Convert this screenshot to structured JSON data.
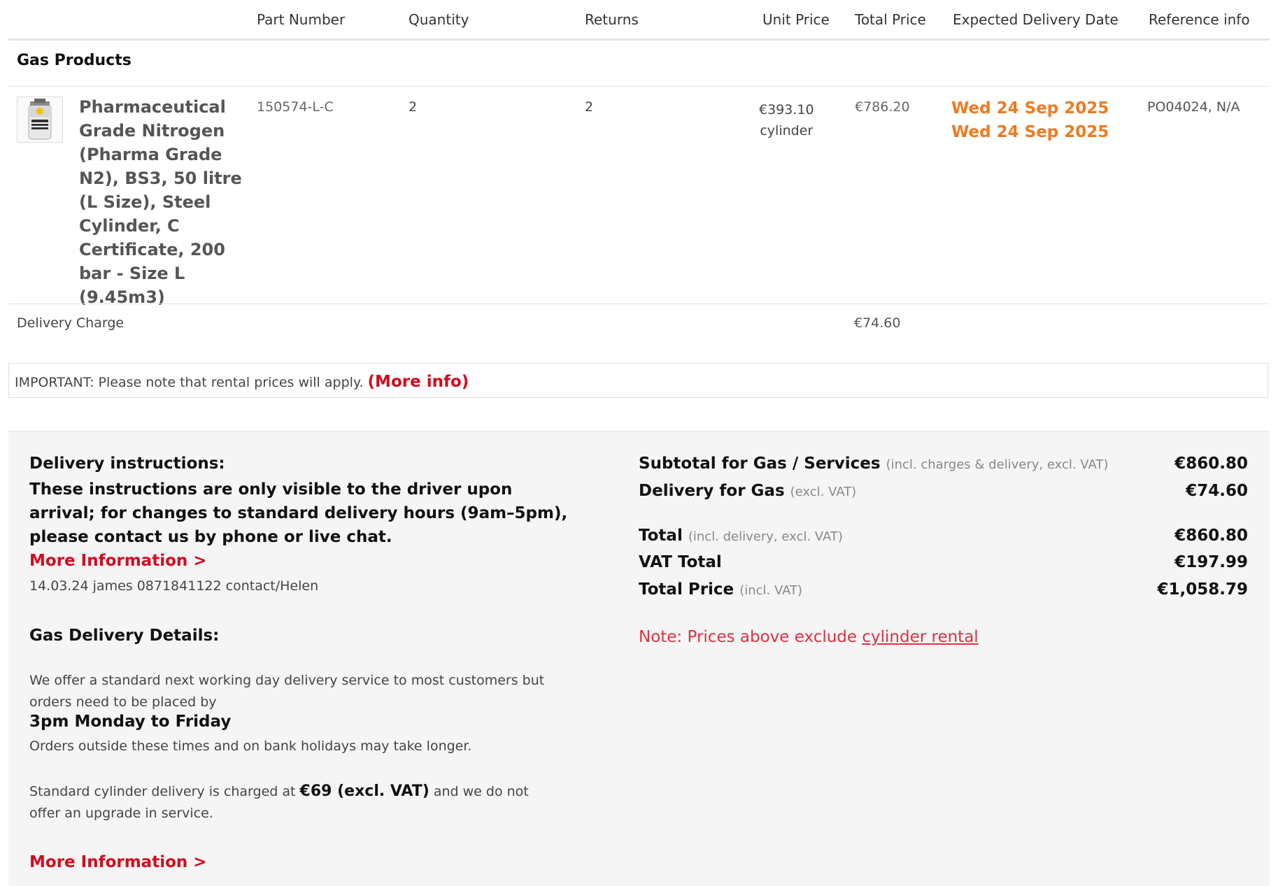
{
  "table": {
    "headers": {
      "part_number": "Part Number",
      "quantity": "Quantity",
      "returns": "Returns",
      "unit_price": "Unit Price",
      "total_price": "Total Price",
      "delivery_date": "Expected Delivery Date",
      "reference": "Reference info"
    },
    "section_title": "Gas Products",
    "rows": [
      {
        "name": "Pharmaceutical Grade Nitrogen (Pharma Grade N2), BS3, 50 litre (L Size), Steel Cylinder, C Certificate, 200 bar - Size L (9.45m3)",
        "part_number": "150574-L-C",
        "quantity": "2",
        "returns": "2",
        "unit_price": "€393.10",
        "unit": "cylinder",
        "total_price": "€786.20",
        "delivery_date_1": "Wed 24 Sep 2025",
        "delivery_date_2": "Wed 24 Sep 2025",
        "reference": "PO04024, N/A"
      }
    ],
    "delivery_charge": {
      "label": "Delivery Charge",
      "value": "€74.60"
    }
  },
  "notice": {
    "text": "IMPORTANT: Please note that rental prices will apply.",
    "link": "(More info)"
  },
  "delivery_instructions": {
    "title": "Delivery instructions:",
    "body": "These instructions are only visible to the driver upon arrival; for changes to standard delivery hours (9am–5pm), please contact us by phone or live chat.",
    "link": "More Information >",
    "note": "14.03.24 james 0871841122 contact/Helen"
  },
  "gas_delivery": {
    "title": "Gas Delivery Details:",
    "p1": "We offer a standard next working day delivery service to most customers but orders need to be placed by",
    "time": "3pm Monday to Friday",
    "p2": "Orders outside these times and on bank holidays may take longer.",
    "p3_before": "Standard cylinder delivery is charged at",
    "p3_bold": "€69 (excl. VAT)",
    "p3_after": "and we do not offer an upgrade in service.",
    "link": "More Information >"
  },
  "summary": {
    "subtotal": {
      "label": "Subtotal for Gas / Services",
      "note": "(incl. charges & delivery, excl. VAT)",
      "value": "€860.80"
    },
    "delivery": {
      "label": "Delivery for Gas",
      "note": "(excl. VAT)",
      "value": "€74.60"
    },
    "total": {
      "label": "Total",
      "note": "(incl. delivery, excl. VAT)",
      "value": "€860.80"
    },
    "vat": {
      "label": "VAT Total",
      "value": "€197.99"
    },
    "total_price": {
      "label": "Total Price",
      "note": "(incl. VAT)",
      "value": "€1,058.79"
    },
    "note_prefix": "Note: Prices above exclude",
    "note_link": "cylinder rental"
  },
  "colors": {
    "accent_red": "#d40a1e",
    "date_orange": "#f07a1f",
    "note_red": "#e03040"
  },
  "icons": {
    "product_thumbnail": "gas-cylinder-icon"
  }
}
